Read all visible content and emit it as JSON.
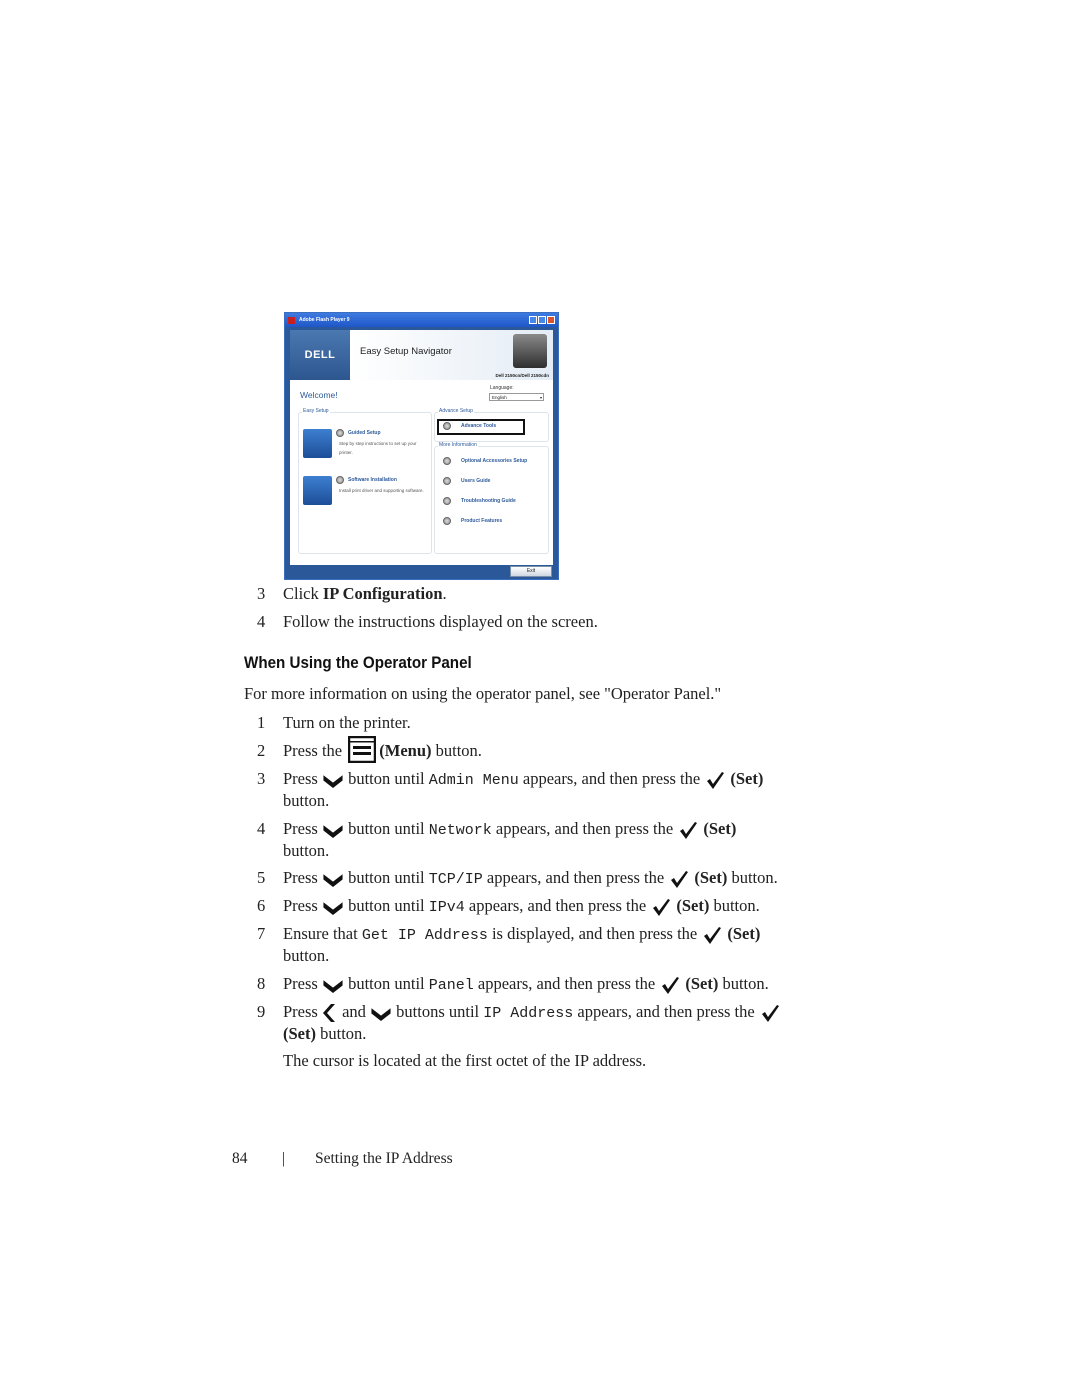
{
  "screenshot": {
    "window_title": "Adobe Flash Player 9",
    "brand": "DELL",
    "app_title": "Easy Setup Navigator",
    "model": "Dell 2150cn/Dell 2150cdn",
    "welcome": "Welcome!",
    "language_label": "Language:",
    "language_value": "English",
    "easy_setup": {
      "title": "Easy Setup",
      "items": [
        {
          "label": "Guided Setup",
          "desc": "Step by step instructions to set up your printer."
        },
        {
          "label": "Software Installation",
          "desc": "Install print driver and supporting software."
        }
      ]
    },
    "advance_setup": {
      "title": "Advance Setup",
      "items": [
        "Advance Tools"
      ]
    },
    "more_information": {
      "title": "More Information",
      "items": [
        "Optional Accessories Setup",
        "Users Guide",
        "Troubleshooting Guide",
        "Product Features"
      ]
    },
    "exit_label": "Exit"
  },
  "steps_top": [
    {
      "num": "3",
      "pre": "Click ",
      "bold": "IP Configuration",
      "post": "."
    },
    {
      "num": "4",
      "text": "Follow the instructions displayed on the screen."
    }
  ],
  "section_heading": "When Using the Operator Panel",
  "intro": "For more information on using the operator panel, see \"Operator Panel.\"",
  "steps": {
    "s1": {
      "num": "1",
      "text": "Turn on the printer."
    },
    "s2": {
      "num": "2",
      "pre": "Press the ",
      "bold": "(Menu)",
      "post": " button."
    },
    "s3": {
      "num": "3",
      "pre": "Press ",
      "mid": " button until ",
      "code": "Admin Menu",
      "post": " appears, and then press the ",
      "bold": "(Set)",
      "tail": "button."
    },
    "s4": {
      "num": "4",
      "pre": "Press ",
      "mid": " button until ",
      "code": "Network",
      "post": " appears, and then press the ",
      "bold": "(Set)",
      "tail": "button."
    },
    "s5": {
      "num": "5",
      "pre": "Press ",
      "mid": " button until ",
      "code": "TCP/IP",
      "post": " appears, and then press the ",
      "bold": "(Set)",
      "tail": " button."
    },
    "s6": {
      "num": "6",
      "pre": "Press ",
      "mid": " button until ",
      "code": "IPv4",
      "post": " appears, and then press the ",
      "bold": "(Set)",
      "tail": " button."
    },
    "s7": {
      "num": "7",
      "pre": "Ensure that ",
      "code": "Get IP Address",
      "post": " is displayed, and then press the ",
      "bold": "(Set)",
      "tail": "button."
    },
    "s8": {
      "num": "8",
      "pre": "Press ",
      "mid": " button until ",
      "code": "Panel",
      "post": " appears, and then press the ",
      "bold": "(Set)",
      "tail": " button."
    },
    "s9": {
      "num": "9",
      "pre": "Press ",
      "and": " and ",
      "mid": " buttons until ",
      "code": "IP Address",
      "post": " appears, and then press the ",
      "bold": "(Set)",
      "tail": " button."
    }
  },
  "note": "The cursor is located at the first octet of the IP address.",
  "footer": {
    "page": "84",
    "sep": "|",
    "section": "Setting the IP Address"
  }
}
